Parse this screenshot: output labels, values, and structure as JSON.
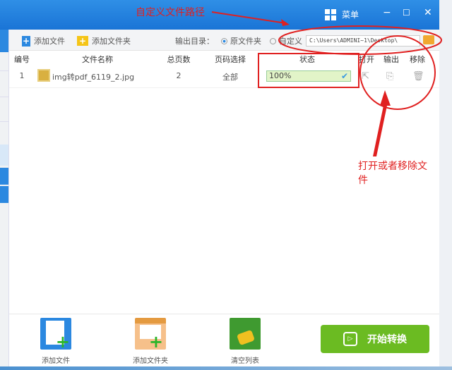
{
  "titlebar": {
    "menu_label": "菜单",
    "minimize": "−",
    "maximize": "☐",
    "close": "✕"
  },
  "toolbar": {
    "add_file": "添加文件",
    "add_folder": "添加文件夹",
    "output_dir_label": "输出目录：",
    "option_original": "原文件夹",
    "option_custom": "自定义",
    "output_path": "C:\\Users\\ADMINI~1\\Desktop\\",
    "selected_option": "原文件夹"
  },
  "table": {
    "headers": [
      "编号",
      "文件名称",
      "总页数",
      "页码选择",
      "状态",
      "打开",
      "输出",
      "移除"
    ],
    "rows": [
      {
        "index": "1",
        "filename": "img转pdf_6119_2.jpg",
        "pages": "2",
        "page_select": "全部",
        "status": "100%",
        "progress": 100
      }
    ]
  },
  "bottom": {
    "add_file": "添加文件",
    "add_folder": "添加文件夹",
    "clear_list": "清空列表",
    "start": "开始转换"
  },
  "annotations": {
    "path_note": "自定义文件路径",
    "action_note_line1": "打开或者移除文",
    "action_note_line2": "件"
  },
  "colors": {
    "title_blue": "#1a74d6",
    "start_green": "#6bbb22",
    "annotation_red": "#e02020"
  }
}
